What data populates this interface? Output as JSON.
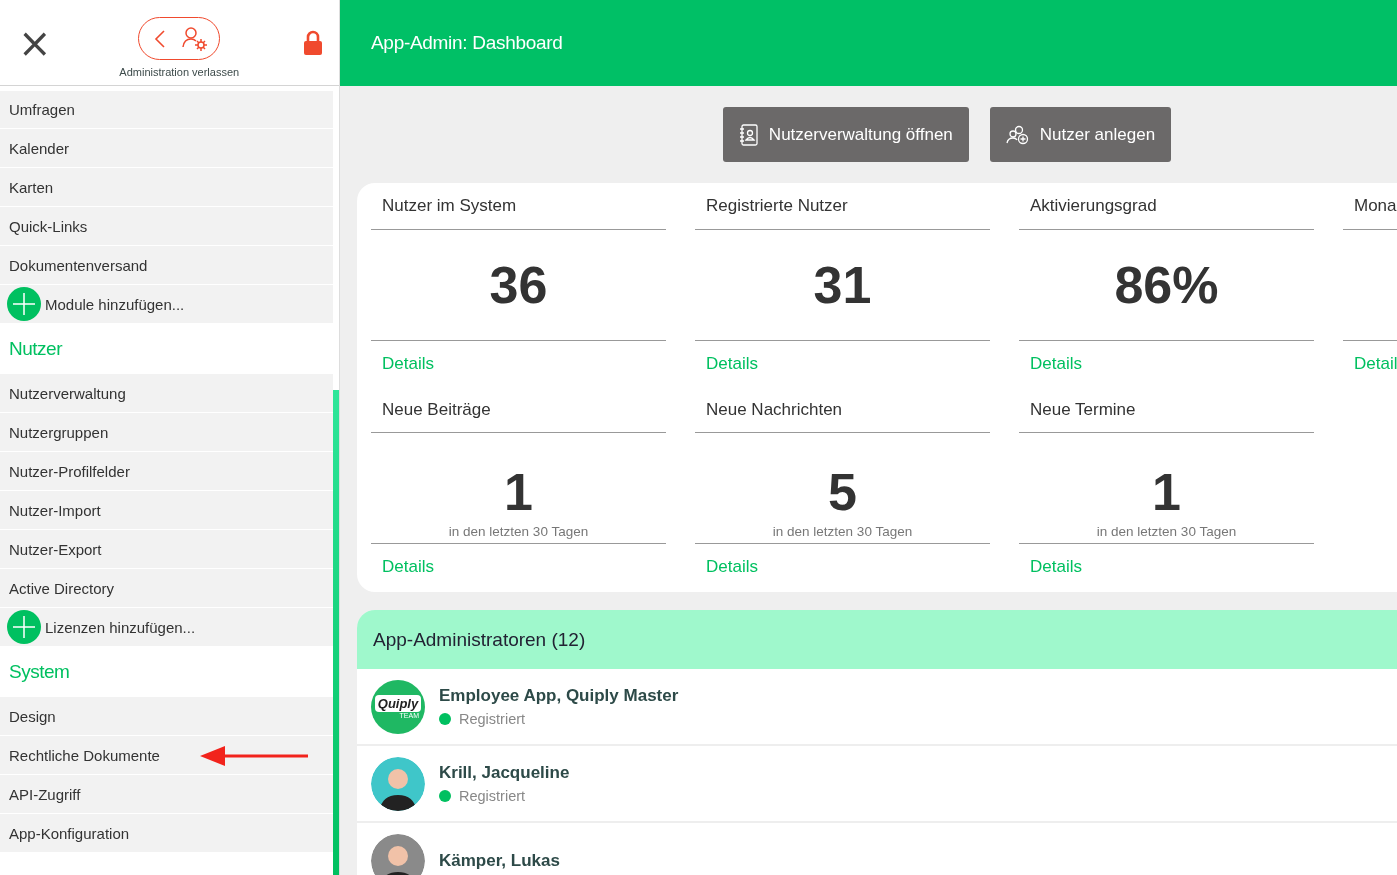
{
  "sidebar": {
    "close_label": "×",
    "back_button": {
      "caption": "Administration verlassen"
    },
    "locked": true,
    "sections": [
      {
        "items": [
          {
            "label": "Umfragen",
            "kind": "link"
          },
          {
            "label": "Kalender",
            "kind": "link"
          },
          {
            "label": "Karten",
            "kind": "link"
          },
          {
            "label": "Quick-Links",
            "kind": "link"
          },
          {
            "label": "Dokumentenversand",
            "kind": "link"
          },
          {
            "label": "Module hinzufügen...",
            "kind": "add"
          }
        ]
      },
      {
        "title": "Nutzer",
        "items": [
          {
            "label": "Nutzerverwaltung",
            "kind": "link"
          },
          {
            "label": "Nutzergruppen",
            "kind": "link"
          },
          {
            "label": "Nutzer-Profilfelder",
            "kind": "link"
          },
          {
            "label": "Nutzer-Import",
            "kind": "link"
          },
          {
            "label": "Nutzer-Export",
            "kind": "link"
          },
          {
            "label": "Active Directory",
            "kind": "link"
          },
          {
            "label": "Lizenzen hinzufügen...",
            "kind": "add"
          }
        ]
      },
      {
        "title": "System",
        "items": [
          {
            "label": "Design",
            "kind": "link"
          },
          {
            "label": "Rechtliche Dokumente",
            "kind": "link",
            "annotated": true
          },
          {
            "label": "API-Zugriff",
            "kind": "link"
          },
          {
            "label": "App-Konfiguration",
            "kind": "link"
          }
        ]
      }
    ]
  },
  "header": {
    "title": "App-Admin: Dashboard"
  },
  "actions": [
    {
      "label": "Nutzerverwaltung öffnen",
      "kind": "directory"
    },
    {
      "label": "Nutzer anlegen",
      "kind": "add-user"
    }
  ],
  "stats_rows": [
    [
      {
        "label": "Nutzer im System",
        "value": "36",
        "link": "Details"
      },
      {
        "label": "Registrierte Nutzer",
        "value": "31",
        "link": "Details"
      },
      {
        "label": "Aktivierungsgrad",
        "value": "86%",
        "link": "Details"
      },
      {
        "label": "Mona",
        "link": "Detail"
      }
    ],
    [
      {
        "label": "Neue Beiträge",
        "value": "1",
        "subtitle": "in den letzten 30 Tagen",
        "link": "Details"
      },
      {
        "label": "Neue Nachrichten",
        "value": "5",
        "subtitle": "in den letzten 30 Tagen",
        "link": "Details"
      },
      {
        "label": "Neue Termine",
        "value": "1",
        "subtitle": "in den letzten 30 Tagen",
        "link": "Details"
      }
    ]
  ],
  "admins": {
    "title": "App-Administratoren (12)",
    "items": [
      {
        "name": "Employee App, Quiply Master",
        "status": "Registriert",
        "color": "#00c060",
        "avatar": {
          "kind": "logo",
          "word": "Quiply",
          "tag": "TEAM"
        }
      },
      {
        "name": "Krill, Jacqueline",
        "status": "Registriert",
        "color": "#00c060",
        "avatar": {
          "kind": "person",
          "color": "#3fc6c9"
        }
      },
      {
        "name": "Kämper, Lukas",
        "avatar": {
          "kind": "person",
          "color": "#8a8a8a"
        }
      }
    ]
  }
}
